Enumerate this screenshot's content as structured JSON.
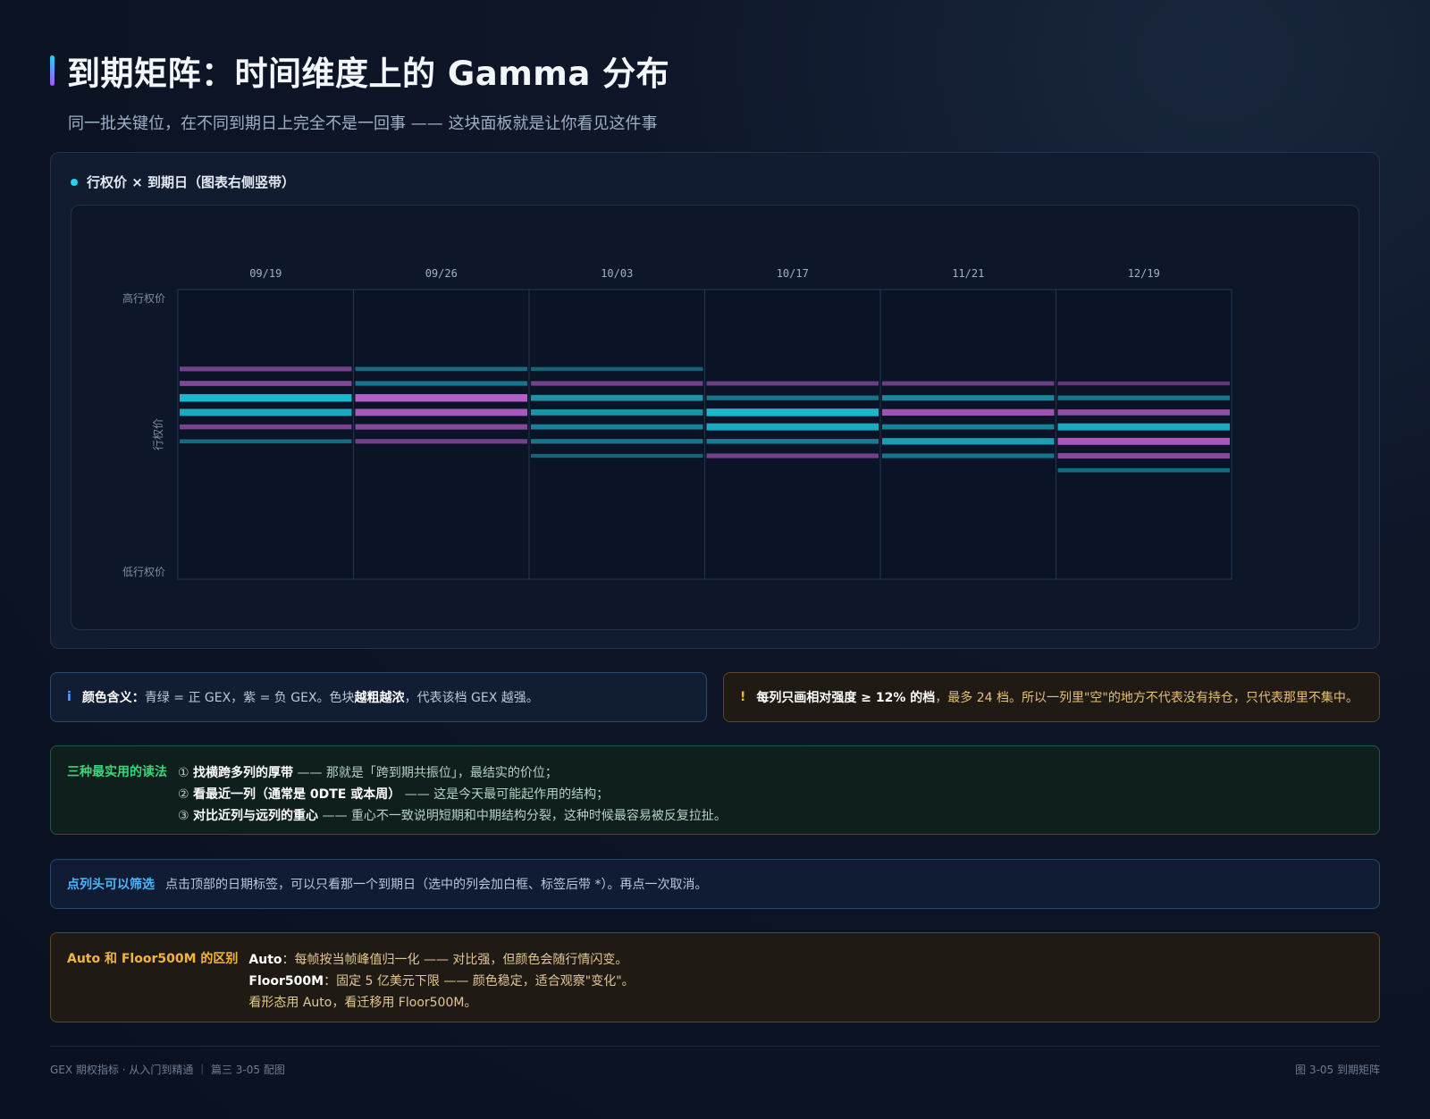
{
  "header": {
    "title": "到期矩阵：时间维度上的 Gamma 分布",
    "subtitle": "同一批关键位，在不同到期日上完全不是一回事 —— 这块面板就是让你看见这件事"
  },
  "panel": {
    "label": "行权价 × 到期日（图表右侧竖带）"
  },
  "colors": {
    "positive": "#1fb5cc",
    "negative": "#b45ec8",
    "accent_info": "#4ea6ff",
    "accent_warn": "#f5b53b",
    "accent_green": "#3fd37a"
  },
  "chart_data": {
    "type": "heatmap",
    "x_categories": [
      "09/19",
      "09/26",
      "10/03",
      "10/17",
      "11/21",
      "12/19"
    ],
    "y_axis_label": "行权价",
    "y_top_label": "高行权价",
    "y_bottom_label": "低行权价",
    "strike_levels": 12,
    "legend": {
      "positive": "正 GEX",
      "negative": "负 GEX"
    },
    "columns": [
      {
        "date": "09/19",
        "bands": [
          {
            "level": 4,
            "sign": "negative",
            "strength": 0.45
          },
          {
            "level": 5,
            "sign": "negative",
            "strength": 0.55
          },
          {
            "level": 6,
            "sign": "positive",
            "strength": 1.0
          },
          {
            "level": 7,
            "sign": "positive",
            "strength": 0.9
          },
          {
            "level": 8,
            "sign": "negative",
            "strength": 0.5
          },
          {
            "level": 9,
            "sign": "positive",
            "strength": 0.35
          }
        ]
      },
      {
        "date": "09/26",
        "bands": [
          {
            "level": 4,
            "sign": "positive",
            "strength": 0.35
          },
          {
            "level": 5,
            "sign": "positive",
            "strength": 0.45
          },
          {
            "level": 6,
            "sign": "negative",
            "strength": 1.0
          },
          {
            "level": 7,
            "sign": "negative",
            "strength": 0.9
          },
          {
            "level": 8,
            "sign": "negative",
            "strength": 0.6
          },
          {
            "level": 9,
            "sign": "negative",
            "strength": 0.45
          }
        ]
      },
      {
        "date": "10/03",
        "bands": [
          {
            "level": 4,
            "sign": "positive",
            "strength": 0.3
          },
          {
            "level": 5,
            "sign": "negative",
            "strength": 0.45
          },
          {
            "level": 6,
            "sign": "positive",
            "strength": 0.7
          },
          {
            "level": 7,
            "sign": "positive",
            "strength": 0.7
          },
          {
            "level": 8,
            "sign": "positive",
            "strength": 0.55
          },
          {
            "level": 9,
            "sign": "positive",
            "strength": 0.45
          },
          {
            "level": 10,
            "sign": "positive",
            "strength": 0.3
          }
        ]
      },
      {
        "date": "10/17",
        "bands": [
          {
            "level": 5,
            "sign": "negative",
            "strength": 0.4
          },
          {
            "level": 6,
            "sign": "positive",
            "strength": 0.45
          },
          {
            "level": 7,
            "sign": "positive",
            "strength": 1.0
          },
          {
            "level": 8,
            "sign": "positive",
            "strength": 0.9
          },
          {
            "level": 9,
            "sign": "positive",
            "strength": 0.5
          },
          {
            "level": 10,
            "sign": "negative",
            "strength": 0.45
          }
        ]
      },
      {
        "date": "11/21",
        "bands": [
          {
            "level": 5,
            "sign": "negative",
            "strength": 0.4
          },
          {
            "level": 6,
            "sign": "positive",
            "strength": 0.6
          },
          {
            "level": 7,
            "sign": "negative",
            "strength": 0.8
          },
          {
            "level": 8,
            "sign": "positive",
            "strength": 0.55
          },
          {
            "level": 9,
            "sign": "positive",
            "strength": 0.8
          },
          {
            "level": 10,
            "sign": "positive",
            "strength": 0.45
          }
        ]
      },
      {
        "date": "12/19",
        "bands": [
          {
            "level": 5,
            "sign": "negative",
            "strength": 0.3
          },
          {
            "level": 6,
            "sign": "positive",
            "strength": 0.45
          },
          {
            "level": 7,
            "sign": "negative",
            "strength": 0.7
          },
          {
            "level": 8,
            "sign": "positive",
            "strength": 0.9
          },
          {
            "level": 9,
            "sign": "negative",
            "strength": 0.9
          },
          {
            "level": 10,
            "sign": "negative",
            "strength": 0.6
          },
          {
            "level": 11,
            "sign": "positive",
            "strength": 0.35
          }
        ]
      }
    ]
  },
  "callouts": {
    "info": {
      "icon": "i",
      "lead": "颜色含义：",
      "text1": "青绿 = 正 GEX，紫 = 负 GEX。色块",
      "emph": "越粗越浓",
      "text2": "，代表该档 GEX 越强。"
    },
    "warn": {
      "icon": "!",
      "lead": "每列只画相对强度 ≥ 12% 的档",
      "text": "，最多 24 档。所以一列里\"空\"的地方不代表没有持仓，只代表那里不集中。"
    },
    "reading": {
      "lead": "三种最实用的读法",
      "l1_num": "①",
      "l1_b": "找横跨多列的厚带",
      "l1_t": " —— 那就是「跨到期共振位」，最结实的价位；",
      "l2_num": "②",
      "l2_b": "看最近一列（通常是 0DTE 或本周）",
      "l2_t": " —— 这是今天最可能起作用的结构；",
      "l3_num": "③",
      "l3_b": "对比近列与远列的重心",
      "l3_t": " —— 重心不一致说明短期和中期结构分裂，这种时候最容易被反复拉扯。"
    },
    "filter": {
      "lead": "点列头可以筛选",
      "text": "点击顶部的日期标签，可以只看那一个到期日（选中的列会加白框、标签后带 *）。再点一次取消。"
    },
    "mode": {
      "lead": "Auto 和 Floor500M 的区别",
      "l1_b": "Auto",
      "l1_t": "：每帧按当帧峰值归一化 —— 对比强，但颜色会随行情闪变。",
      "l2_b": "Floor500M",
      "l2_t": "：固定 5 亿美元下限 —— 颜色稳定，适合观察\"变化\"。",
      "l3_t": "看形态用 Auto，看迁移用 Floor500M。"
    }
  },
  "footer": {
    "left": "GEX 期权指标 · 从入门到精通 ｜ 篇三 3-05 配图",
    "right": "图 3-05 到期矩阵"
  }
}
